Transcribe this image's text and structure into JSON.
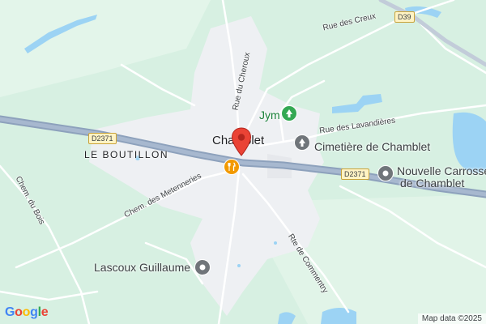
{
  "map": {
    "town": "Chamblet",
    "hamlet": "LE BOUTILLON",
    "streets": {
      "rue_des_creux": "Rue des Creux",
      "rue_du_cheroux": "Rue du Cheroux",
      "rue_des_lavandieres": "Rue des Lavandières",
      "chem_des_metenneries": "Chem. des Metenneries",
      "chem_du_bois": "Chem. du Bois",
      "rte_de_commentry": "Rte de Commentry"
    },
    "road_shields": {
      "d2371_west": "D2371",
      "d2371_east": "D2371",
      "d39": "D39"
    },
    "pois": {
      "jym": "Jym",
      "cemetery": "Cimetière de Chamblet",
      "carrosserie_line1": "Nouvelle Carrosserie",
      "carrosserie_line2": "de Chamblet",
      "lascoux": "Lascoux Guillaume"
    },
    "icons": {
      "park": "tree-icon",
      "cemetery": "cemetery-icon",
      "service": "service-pin-icon",
      "restaurant": "restaurant-icon",
      "marker": "location-marker-icon"
    },
    "colors": {
      "land": "#d7f0e2",
      "urban": "#eef0f3",
      "water": "#9cd3f4",
      "main_road": "#8da1bc",
      "marker": "#ea4335",
      "restaurant": "#f29900",
      "park_icon": "#34a853",
      "grey_icon": "#70757a"
    }
  },
  "logo": {
    "g1": "G",
    "o1": "o",
    "o2": "o",
    "g2": "g",
    "l": "l",
    "e": "e"
  },
  "attribution": "Map data ©2025"
}
